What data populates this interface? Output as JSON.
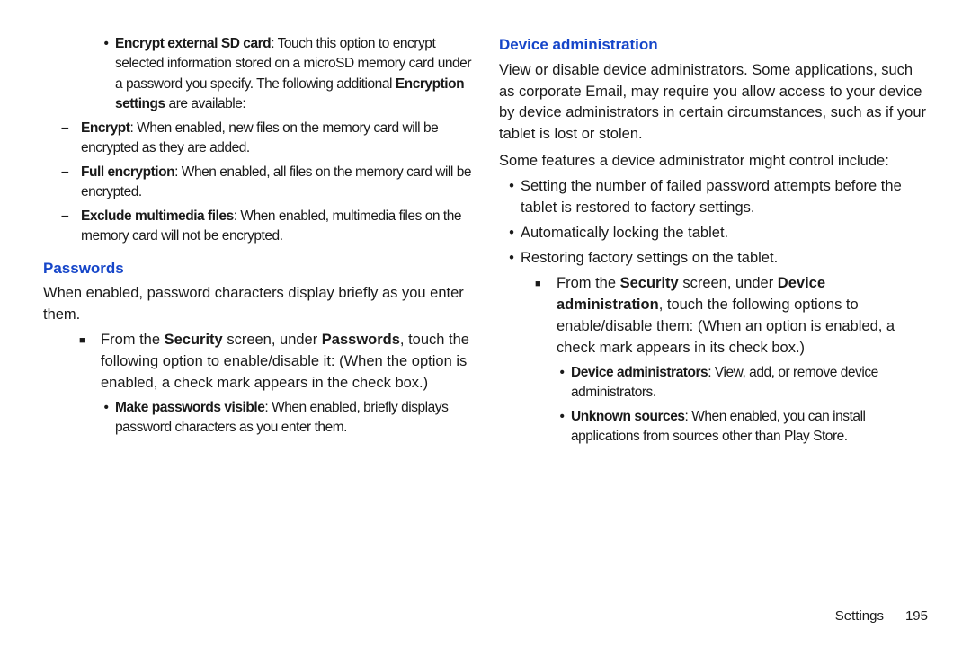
{
  "left": {
    "encrypt_sd": {
      "title": "Encrypt external SD card",
      "after_title": ":   Touch this option to encrypt selected information stored on a microSD memory card under a password you specify. The following additional ",
      "enc_settings_bold": "Encryption settings",
      "tail": " are available:",
      "sub": [
        {
          "t": "Encrypt",
          "d": ": When enabled, new files on the memory card will be encrypted as they are added."
        },
        {
          "t": "Full encryption",
          "d": ": When enabled, all files on the memory card will be encrypted."
        },
        {
          "t": "Exclude multimedia files",
          "d": ": When enabled, multimedia files on the memory card will not be encrypted."
        }
      ]
    },
    "passwords": {
      "heading": "Passwords",
      "intro": "When enabled, password characters display briefly as you enter them.",
      "square": {
        "pre": "From the ",
        "b1": "Security",
        "mid": " screen, under ",
        "b2": "Passwords",
        "post": ", touch the following option to enable/disable it: (When the option is enabled, a check mark appears in the check box.)"
      },
      "sub": {
        "t": "Make passwords visible",
        "d": ": When enabled, briefly displays password characters as you enter them."
      }
    }
  },
  "right": {
    "heading": "Device administration",
    "p1": "View or disable device administrators. Some applications, such as corporate Email, may require you allow access to your device by device administrators in certain circumstances, such as if your tablet is lost or stolen.",
    "p2": "Some features a device administrator might control include:",
    "bullets": [
      "Setting the number of failed password attempts before the tablet is restored to factory settings.",
      "Automatically locking the tablet.",
      "Restoring factory settings on the tablet."
    ],
    "square": {
      "pre": "From the ",
      "b1": "Security",
      "mid": " screen, under ",
      "b2": "Device administration",
      "post": ", touch the following options to enable/disable them: (When an option is enabled, a check mark appears in its check box.)"
    },
    "sub": [
      {
        "t": "Device administrators",
        "d": ": View, add, or remove device administrators."
      },
      {
        "t": "Unknown sources",
        "d": ": When enabled, you can install applications from sources other than Play Store."
      }
    ]
  },
  "footer": {
    "label": "Settings",
    "page": "195"
  }
}
